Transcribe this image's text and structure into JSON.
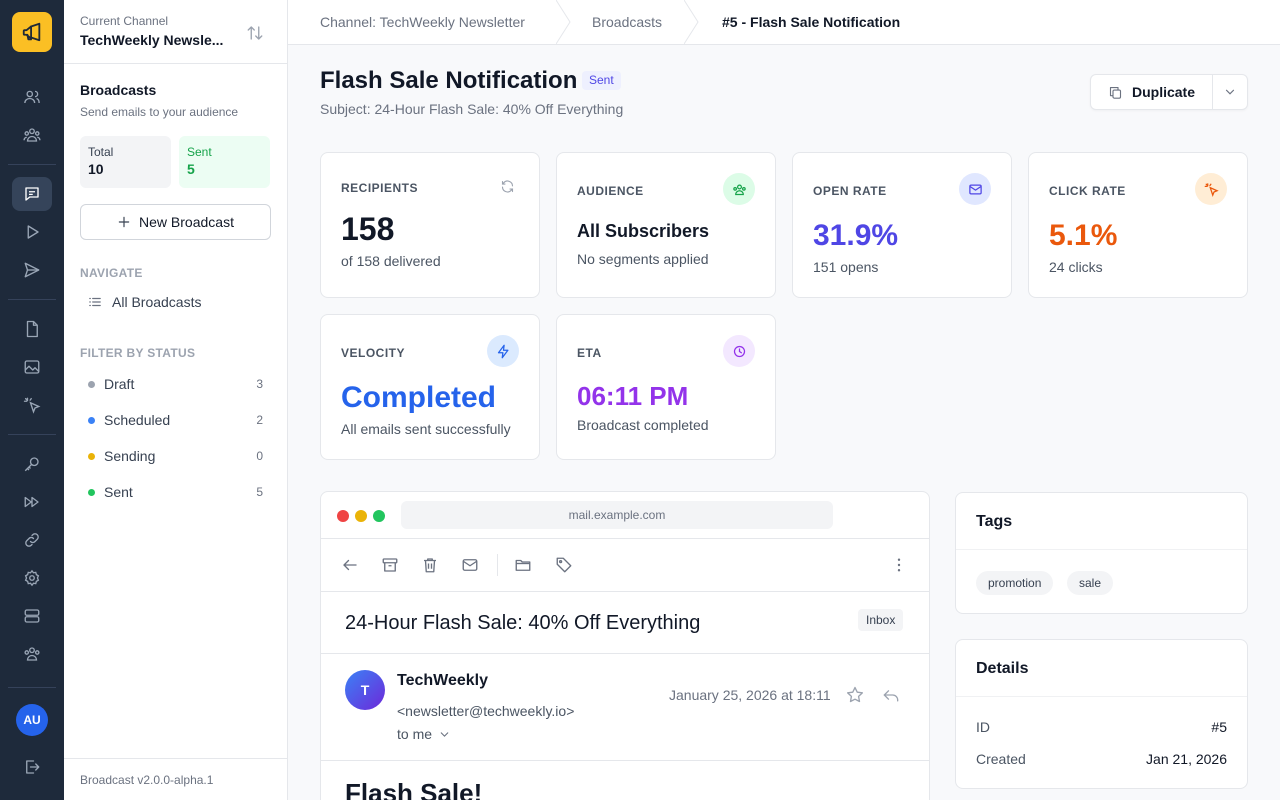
{
  "sidebar": {
    "current_channel_label": "Current Channel",
    "channel_name": "TechWeekly Newsle...",
    "title": "Broadcasts",
    "subtitle": "Send emails to your audience",
    "total_label": "Total",
    "total_value": "10",
    "sent_label": "Sent",
    "sent_value": "5",
    "new_broadcast_label": "New Broadcast",
    "navigate_heading": "NAVIGATE",
    "all_broadcasts_label": "All Broadcasts",
    "filter_heading": "FILTER BY STATUS",
    "filters": [
      {
        "label": "Draft",
        "count": "3",
        "color": "#9ca3af"
      },
      {
        "label": "Scheduled",
        "count": "2",
        "color": "#3b82f6"
      },
      {
        "label": "Sending",
        "count": "0",
        "color": "#eab308"
      },
      {
        "label": "Sent",
        "count": "5",
        "color": "#22c55e"
      }
    ],
    "version": "Broadcast v2.0.0-alpha.1"
  },
  "rail": {
    "avatar_initials": "AU",
    "icons": [
      "megaphone-icon",
      "users-icon",
      "team-icon",
      "chat-icon",
      "play-icon",
      "send-icon",
      "file-icon",
      "image-icon",
      "pointer-icon",
      "key-icon",
      "fast-forward-icon",
      "link-icon",
      "settings-icon",
      "storage-icon",
      "group-icon",
      "logout-icon"
    ]
  },
  "breadcrumb": {
    "channel": "Channel: TechWeekly Newsletter",
    "section": "Broadcasts",
    "current": "#5 - Flash Sale Notification"
  },
  "header": {
    "title": "Flash Sale Notification",
    "status_badge": "Sent",
    "subject": "Subject: 24-Hour Flash Sale: 40% Off Everything",
    "duplicate_label": "Duplicate"
  },
  "metrics": {
    "recipients": {
      "label": "RECIPIENTS",
      "value": "158",
      "sub": "of 158 delivered"
    },
    "audience": {
      "label": "AUDIENCE",
      "value": "All Subscribers",
      "sub": "No segments applied"
    },
    "open_rate": {
      "label": "OPEN RATE",
      "value": "31.9%",
      "sub": "151 opens",
      "color": "#4f46e5"
    },
    "click_rate": {
      "label": "CLICK RATE",
      "value": "5.1%",
      "sub": "24 clicks",
      "color": "#ea580c"
    },
    "velocity": {
      "label": "VELOCITY",
      "value": "Completed",
      "sub": "All emails sent successfully",
      "color": "#2563eb"
    },
    "eta": {
      "label": "ETA",
      "value": "06:11 PM",
      "sub": "Broadcast completed",
      "color": "#9333ea"
    }
  },
  "email": {
    "url": "mail.example.com",
    "subject": "24-Hour Flash Sale: 40% Off Everything",
    "folder_badge": "Inbox",
    "sender_initial": "T",
    "sender_name": "TechWeekly",
    "sender_email": "<newsletter@techweekly.io>",
    "to": "to me",
    "date": "January 25, 2026 at 18:11",
    "body_heading": "Flash Sale!"
  },
  "tags": {
    "title": "Tags",
    "items": [
      "promotion",
      "sale"
    ]
  },
  "details": {
    "title": "Details",
    "id_label": "ID",
    "id_value": "#5",
    "created_label": "Created",
    "created_value": "Jan 21, 2026"
  }
}
